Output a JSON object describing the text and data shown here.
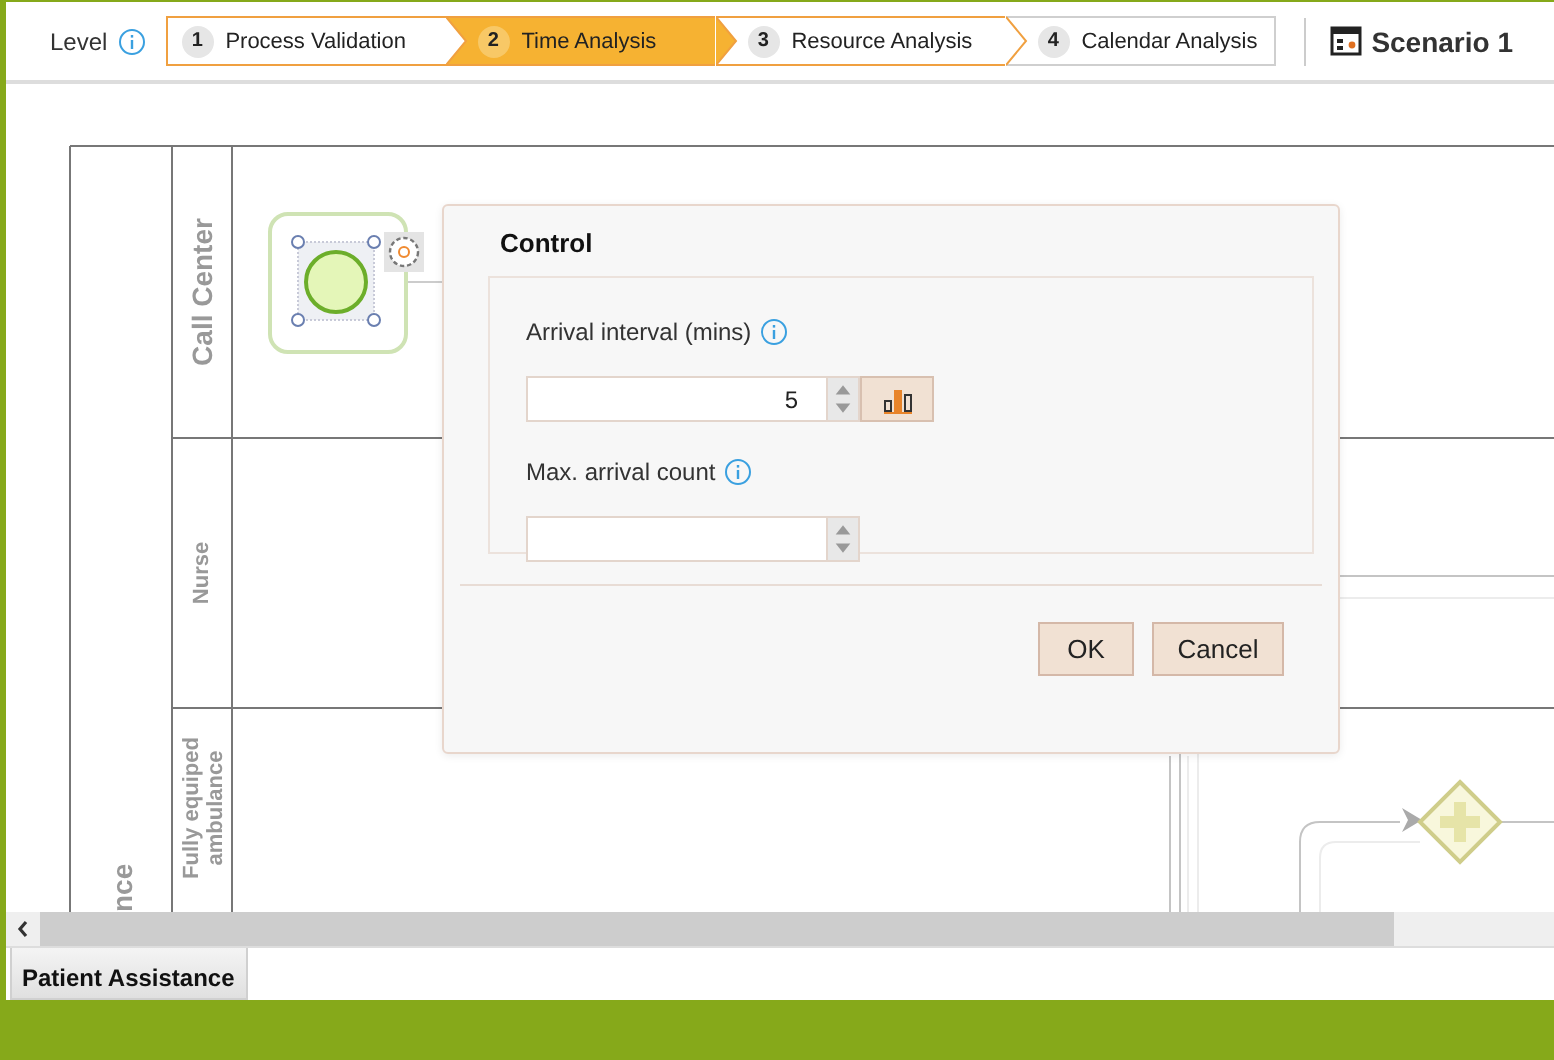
{
  "toolbar": {
    "level_label": "Level",
    "steps": [
      {
        "number": "1",
        "label": "Process Validation",
        "selected": false
      },
      {
        "number": "2",
        "label": "Time Analysis",
        "selected": true
      },
      {
        "number": "3",
        "label": "Resource Analysis",
        "selected": false
      },
      {
        "number": "4",
        "label": "Calendar Analysis",
        "selected": false
      }
    ],
    "scenario": "Scenario 1"
  },
  "diagram": {
    "pool_label": "nce",
    "lanes": [
      {
        "name": "Call Center"
      },
      {
        "name": "Nurse"
      },
      {
        "name": "Fully equiped ambulance"
      }
    ]
  },
  "dialog": {
    "title": "Control",
    "fields": [
      {
        "label": "Arrival interval (mins)",
        "value": "5",
        "kind": "distribution"
      },
      {
        "label": "Max. arrival count",
        "kind": "plain"
      }
    ],
    "buttons": [
      "OK",
      "Cancel"
    ]
  },
  "tabs": [
    {
      "label": "Patient Assistance",
      "selected": true
    }
  ]
}
